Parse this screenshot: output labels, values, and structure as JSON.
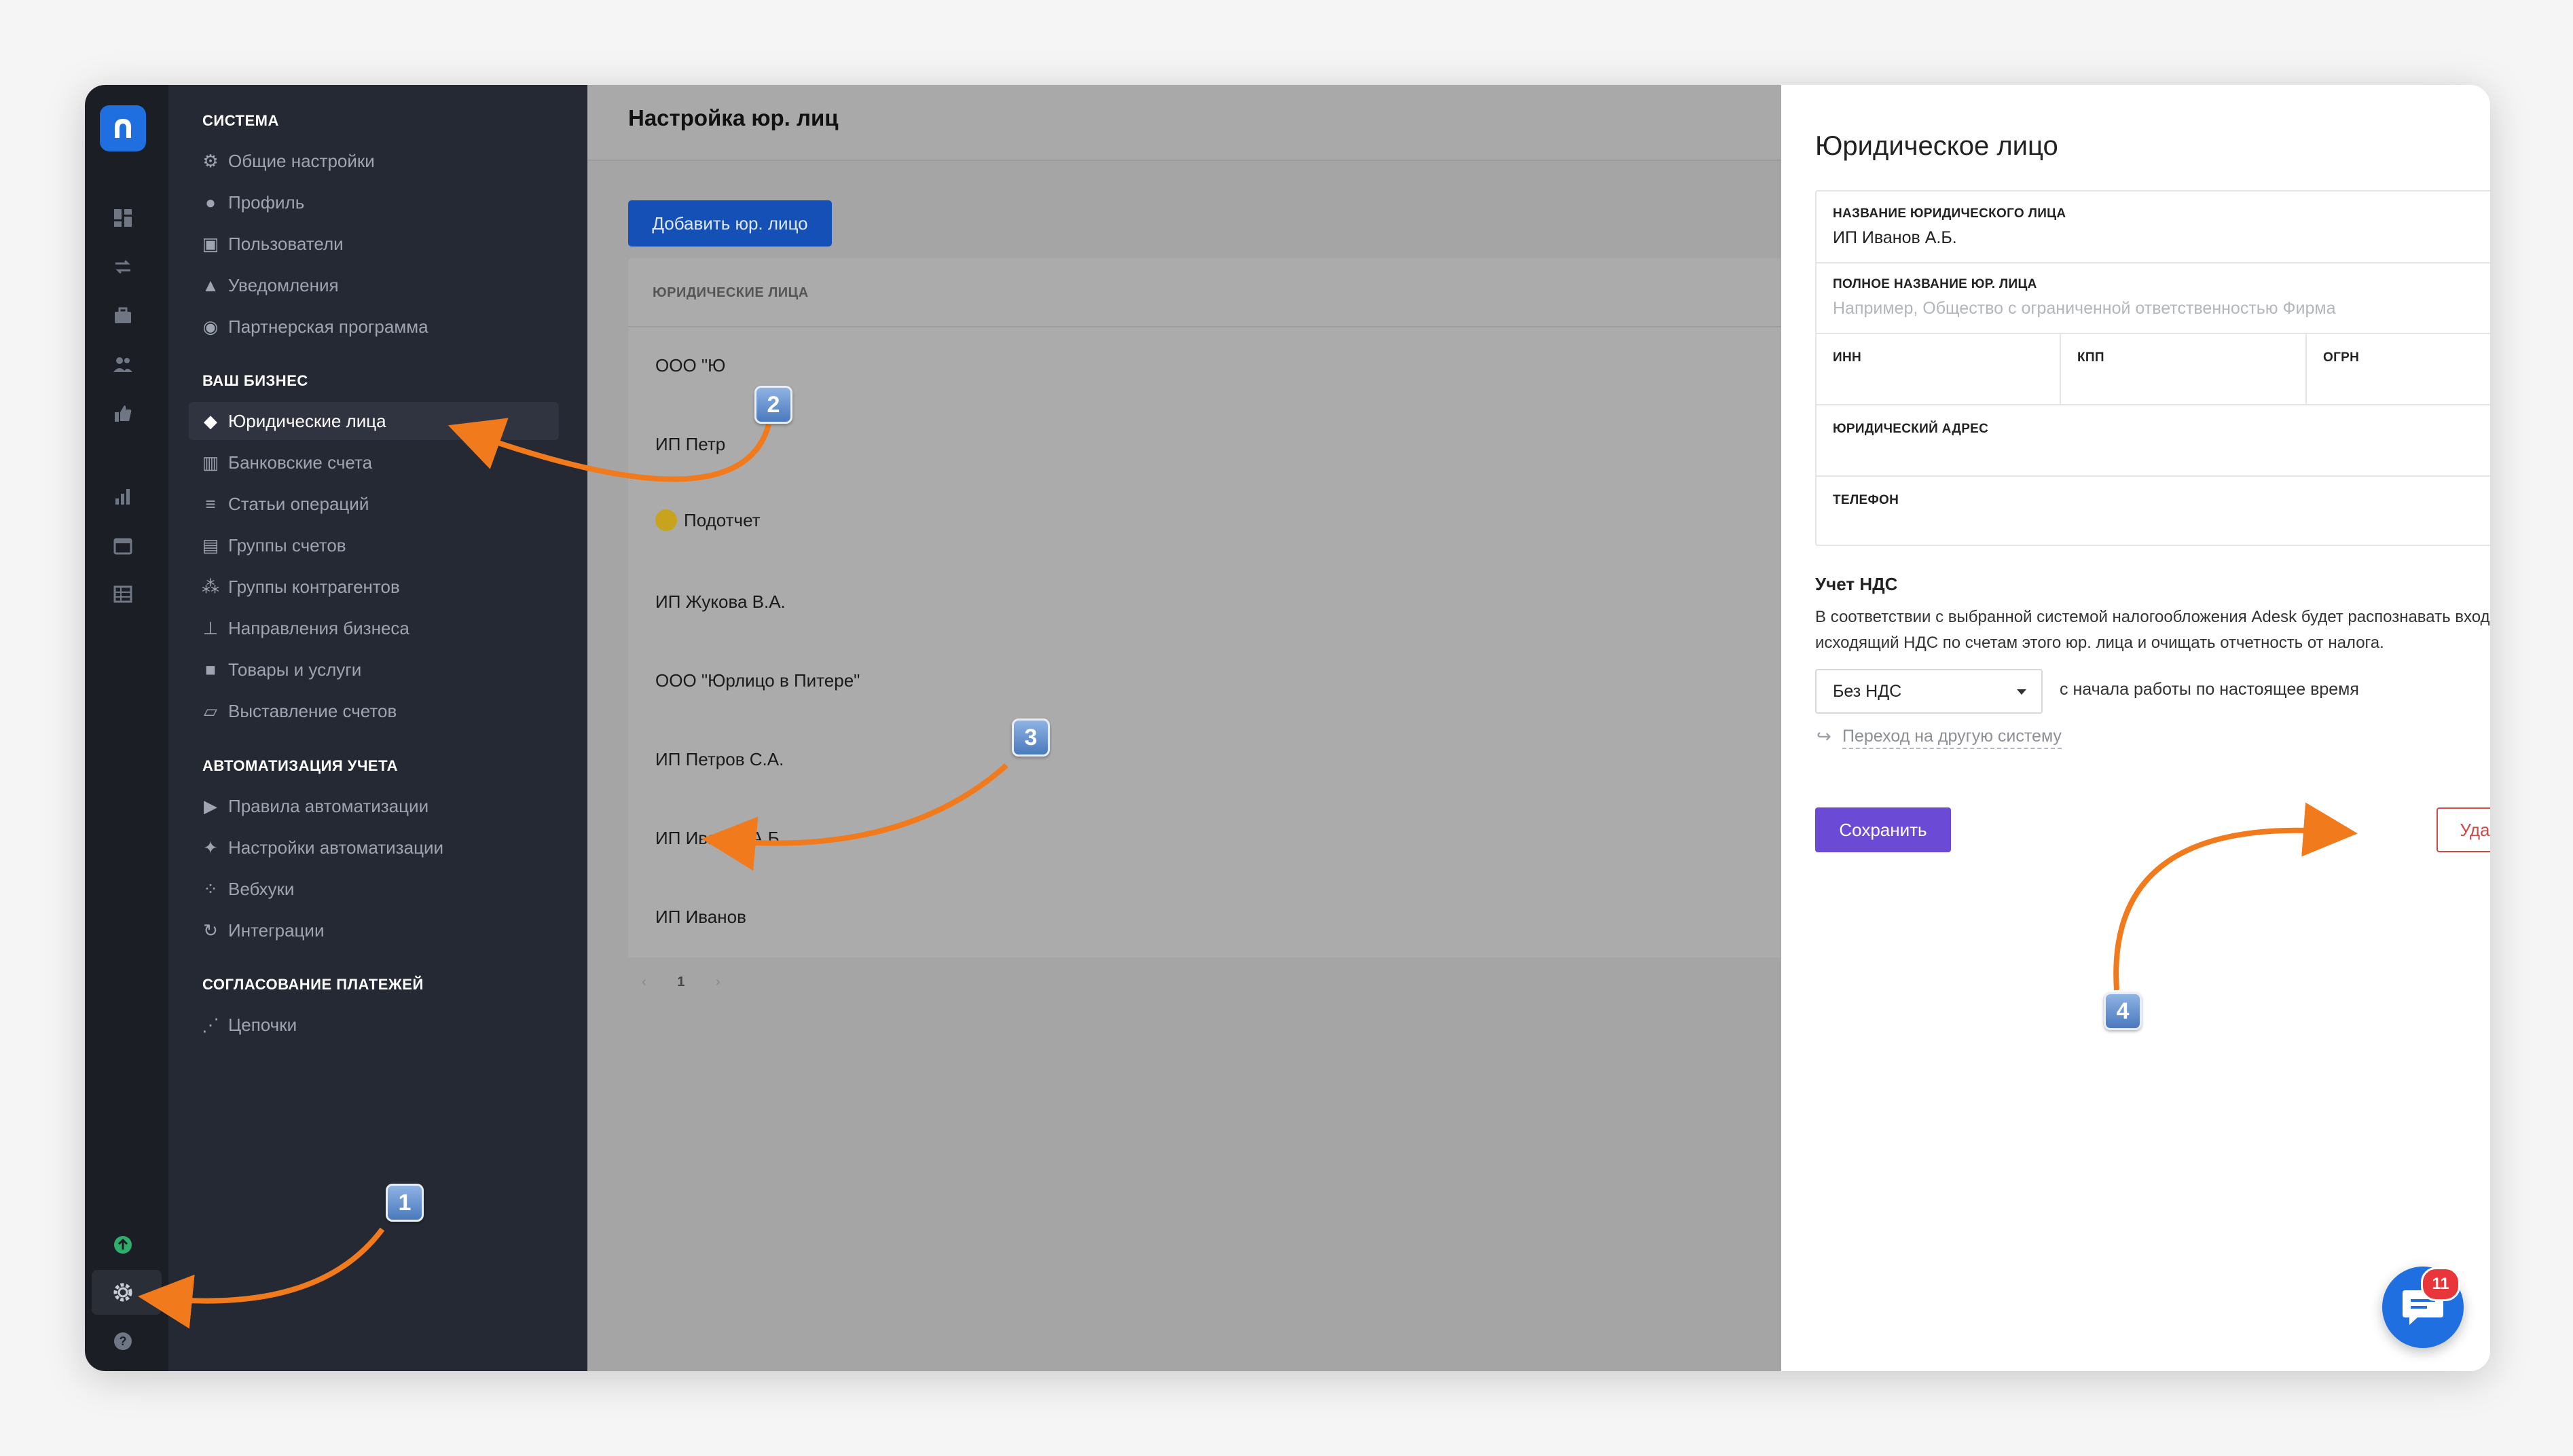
{
  "sidebar": {
    "sections": [
      {
        "title": "СИСТЕМА",
        "items": [
          {
            "label": "Общие настройки",
            "icon": "cogs-icon"
          },
          {
            "label": "Профиль",
            "icon": "user-icon"
          },
          {
            "label": "Пользователи",
            "icon": "users-book-icon"
          },
          {
            "label": "Уведомления",
            "icon": "bell-icon"
          },
          {
            "label": "Партнерская программа",
            "icon": "coins-icon"
          }
        ]
      },
      {
        "title": "ВАШ БИЗНЕС",
        "items": [
          {
            "label": "Юридические лица",
            "icon": "layers-icon"
          },
          {
            "label": "Банковские счета",
            "icon": "bank-icon"
          },
          {
            "label": "Статьи операций",
            "icon": "list-icon"
          },
          {
            "label": "Группы счетов",
            "icon": "stack-icon"
          },
          {
            "label": "Группы контрагентов",
            "icon": "people-group-icon"
          },
          {
            "label": "Направления бизнеса",
            "icon": "sitemap-icon"
          },
          {
            "label": "Товары и услуги",
            "icon": "box-icon"
          },
          {
            "label": "Выставление счетов",
            "icon": "invoice-icon"
          }
        ]
      },
      {
        "title": "АВТОМАТИЗАЦИЯ УЧЕТА",
        "items": [
          {
            "label": "Правила автоматизации",
            "icon": "play-icon"
          },
          {
            "label": "Настройки автоматизации",
            "icon": "magic-wand-icon"
          },
          {
            "label": "Вебхуки",
            "icon": "webhook-icon"
          },
          {
            "label": "Интеграции",
            "icon": "sync-icon"
          }
        ]
      },
      {
        "title": "СОГЛАСОВАНИЕ ПЛАТЕЖЕЙ",
        "items": [
          {
            "label": "Цепочки",
            "icon": "chain-icon"
          }
        ]
      }
    ]
  },
  "main": {
    "title": "Настройка юр. лиц",
    "add_button": "Добавить юр. лицо",
    "list_header": "ЮРИДИЧЕСКИЕ ЛИЦА",
    "rows": [
      "ООО \"Ю",
      "ИП Петр",
      "Подотчет",
      "ИП Жукова В.А.",
      "ООО \"Юрлицо в Питере\"",
      "ИП Петров С.А.",
      "ИП Иванов А.Б.",
      "ИП Иванов"
    ],
    "pager": {
      "prev": "‹",
      "page": "1",
      "next": "›"
    }
  },
  "drawer": {
    "title": "Юридическое лицо",
    "fields": {
      "name_label": "НАЗВАНИЕ ЮРИДИЧЕСКОГО ЛИЦА",
      "name_value": "ИП Иванов А.Б.",
      "required_mark": "*",
      "full_name_label": "ПОЛНОЕ НАЗВАНИЕ ЮР. ЛИЦА",
      "full_name_placeholder": "Например, Общество с ограниченной ответственностью Фирма",
      "inn_label": "ИНН",
      "kpp_label": "КПП",
      "ogrn_label": "ОГРН",
      "address_label": "ЮРИДИЧЕСКИЙ АДРЕС",
      "phone_label": "ТЕЛЕФОН"
    },
    "vat": {
      "title": "Учет НДС",
      "description": "В соответствии с выбранной системой налогообложения Adesk будет распознавать входящий и исходящий НДС по счетам этого юр. лица и очищать отчетность от налога.",
      "selected": "Без НДС",
      "period_note": "с начала работы по настоящее время",
      "switch_arrow": "↪",
      "switch_link": "Переход на другую систему"
    },
    "save_button": "Сохранить",
    "delete_button": "Удалить"
  },
  "chat": {
    "badge": "11"
  },
  "annotations": {
    "step1": "1",
    "step2": "2",
    "step3": "3",
    "step4": "4"
  },
  "colors": {
    "accent_orange": "#f07a1c",
    "brand_blue": "#1f6fe0",
    "save_purple": "#6b4ad6",
    "delete_red": "#d24b4b"
  }
}
